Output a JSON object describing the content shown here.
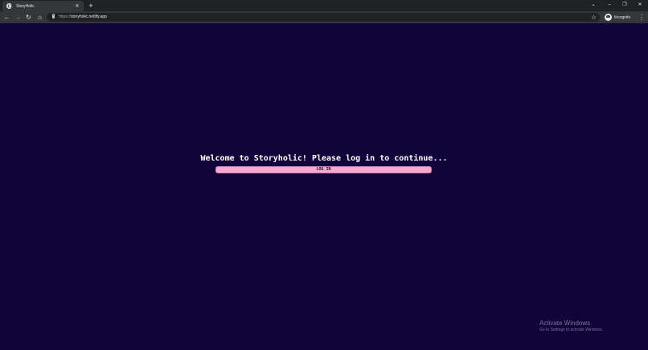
{
  "browser": {
    "tab": {
      "title": "StoryHolic",
      "close_glyph": "✕",
      "favicon": "globe-icon"
    },
    "new_tab_glyph": "+",
    "window_controls": {
      "dropdown": "⌄",
      "minimize": "–",
      "restore": "❐",
      "close": "✕"
    },
    "nav": {
      "back": "←",
      "forward": "→",
      "reload": "↻",
      "home": "⌂"
    },
    "address": {
      "scheme": "https://",
      "host": "storyholic.netlify.app"
    },
    "star_glyph": "☆",
    "profile_label": "Incognito",
    "menu_glyph": "⋮"
  },
  "page": {
    "welcome": "Welcome to Storyholic! Please log in to continue...",
    "login_label": "LOG IN"
  },
  "watermark": {
    "title": "Activate Windows",
    "subtitle": "Go to Settings to activate Windows."
  },
  "colors": {
    "page_background": "#10043a",
    "button_background": "#f7a8d0",
    "chrome_dark": "#202124",
    "chrome_toolbar": "#35363a"
  }
}
